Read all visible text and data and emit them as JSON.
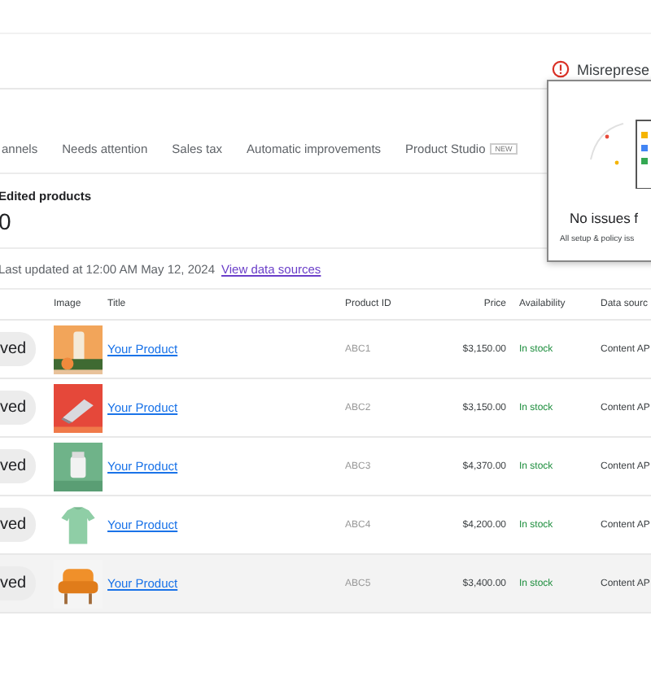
{
  "alert": {
    "text": "Misreprese"
  },
  "popover": {
    "title": "No issues f",
    "subtitle": "All setup & policy iss"
  },
  "tabs": [
    {
      "label": "annels",
      "selected": false
    },
    {
      "label": "Needs attention",
      "selected": false
    },
    {
      "label": "Sales tax",
      "selected": false
    },
    {
      "label": "Automatic improvements",
      "selected": false
    },
    {
      "label": "Product Studio",
      "badge": "NEW",
      "selected": false
    }
  ],
  "summary": {
    "label": "Edited products",
    "value": "0"
  },
  "last_updated": {
    "text": "Last updated at 12:00 AM May 12, 2024",
    "link": "View data sources"
  },
  "table": {
    "columns": [
      "Image",
      "Title",
      "Product ID",
      "Price",
      "Availability",
      "Data sourc"
    ],
    "rows": [
      {
        "status": "ved",
        "title": "Your Product",
        "product_id": "ABC1",
        "price": "$3,150.00",
        "availability": "In stock",
        "data_source": "Content AP",
        "selected": false
      },
      {
        "status": "ved",
        "title": "Your Product",
        "product_id": "ABC2",
        "price": "$3,150.00",
        "availability": "In stock",
        "data_source": "Content AP",
        "selected": false
      },
      {
        "status": "ved",
        "title": "Your Product",
        "product_id": "ABC3",
        "price": "$4,370.00",
        "availability": "In stock",
        "data_source": "Content AP",
        "selected": false
      },
      {
        "status": "ved",
        "title": "Your Product",
        "product_id": "ABC4",
        "price": "$4,200.00",
        "availability": "In stock",
        "data_source": "Content AP",
        "selected": false
      },
      {
        "status": "ved",
        "title": "Your Product",
        "product_id": "ABC5",
        "price": "$3,400.00",
        "availability": "In stock",
        "data_source": "Content AP",
        "selected": true
      }
    ]
  }
}
